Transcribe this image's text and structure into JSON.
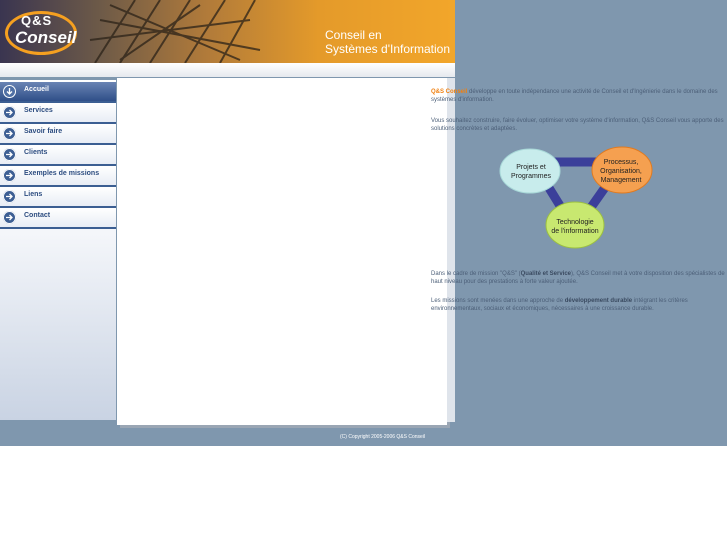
{
  "banner": {
    "logo_line1": "Q&S",
    "logo_line2": "Conseil",
    "title_line1": "Conseil en",
    "title_line2": "Systèmes d'Information"
  },
  "nav": {
    "items": [
      {
        "label": "Accueil",
        "active": true
      },
      {
        "label": "Services",
        "active": false
      },
      {
        "label": "Savoir faire",
        "active": false
      },
      {
        "label": "Clients",
        "active": false
      },
      {
        "label": "Exemples de missions",
        "active": false
      },
      {
        "label": "Liens",
        "active": false
      },
      {
        "label": "Contact",
        "active": false
      }
    ]
  },
  "intro": {
    "brand": "Q&S Conseil",
    "p1_rest": " développe en toute indépendance une activité de Conseil et d'Ingénierie dans le domaine des systèmes d'information.",
    "p2": "Vous souhaitez construire, faire évoluer, optimiser votre système d'information, Q&S Conseil vous apporte des solutions concrètes et adaptées."
  },
  "diagram": {
    "node_left_line1": "Projets et",
    "node_left_line2": "Programmes",
    "node_right_line1": "Processus,",
    "node_right_line2": "Organisation,",
    "node_right_line3": "Management",
    "node_bottom_line1": "Technologie",
    "node_bottom_line2": "de l'information",
    "colors": {
      "left": "#c8ecec",
      "right": "#f5a050",
      "bottom": "#c8e870",
      "connector": "#3b3f9a"
    }
  },
  "mission": {
    "p3_start": "Dans le cadre de mission \"Q&S\" (",
    "p3_strong": "Qualité et Service",
    "p3_end": "), Q&S Conseil met à votre disposition des spécialistes de haut niveau pour des prestations à forte valeur ajoutée.",
    "p4_start": "Les missions sont menées dans une approche de ",
    "p4_strong": "développement durable",
    "p4_end": " intégrant les critères environnementaux, sociaux et économiques, nécessaires à une croissance durable."
  },
  "footer": {
    "copyright": "(C) Copyright 2005-2006 Q&S Conseil"
  },
  "colors": {
    "page_background": "#7f97ae",
    "nav_accent": "#3b5e92",
    "brand_orange": "#f08010"
  }
}
